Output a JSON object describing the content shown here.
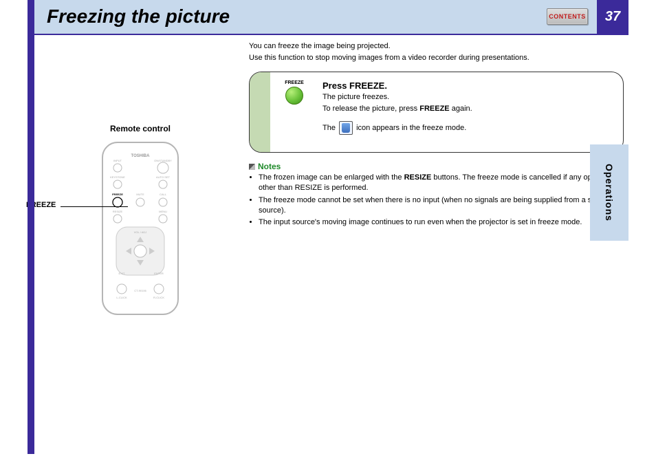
{
  "header": {
    "title": "Freezing the picture",
    "contents_label": "CONTENTS",
    "page_number": "37"
  },
  "side_tab": "Operations",
  "intro": {
    "line1": "You can freeze the image being projected.",
    "line2": "Use this function to stop moving images from a video recorder during presentations."
  },
  "remote": {
    "title": "Remote control",
    "freeze_label": "FREEZE",
    "brand": "TOSHIBA",
    "model": "CT-90106",
    "buttons": {
      "on_standby": "ON/STANDBY",
      "input": "INPUT",
      "keystone": "KEYSTONE",
      "autoset": "AUTO SET",
      "freeze": "FREEZE",
      "mute": "MUTE",
      "call": "CALL",
      "resize": "RESIZE",
      "menu": "MENU",
      "vol_adj": "VOL / ADJ",
      "exit": "EXIT",
      "enter": "ENTER",
      "l_click": "L-CLICK",
      "r_click": "R-CLICK"
    }
  },
  "instruction": {
    "button_tiny": "FREEZE",
    "heading": "Press FREEZE.",
    "line1": "The picture freezes.",
    "line2_pre": "To release the picture, press ",
    "line2_bold": "FREEZE",
    "line2_post": " again.",
    "line3_pre": "The ",
    "line3_post": " icon appears in the freeze mode."
  },
  "notes": {
    "heading": "Notes",
    "items": [
      {
        "pre": "The frozen image can be enlarged with the ",
        "bold": "RESIZE",
        "post": " buttons. The freeze mode is cancelled if any operation other than RESIZE is performed."
      },
      {
        "pre": "The freeze mode cannot be set when there is no input (when no signals are being supplied from a signal source).",
        "bold": "",
        "post": ""
      },
      {
        "pre": "The input source's moving image continues to run even when the projector is set in freeze mode.",
        "bold": "",
        "post": ""
      }
    ]
  }
}
